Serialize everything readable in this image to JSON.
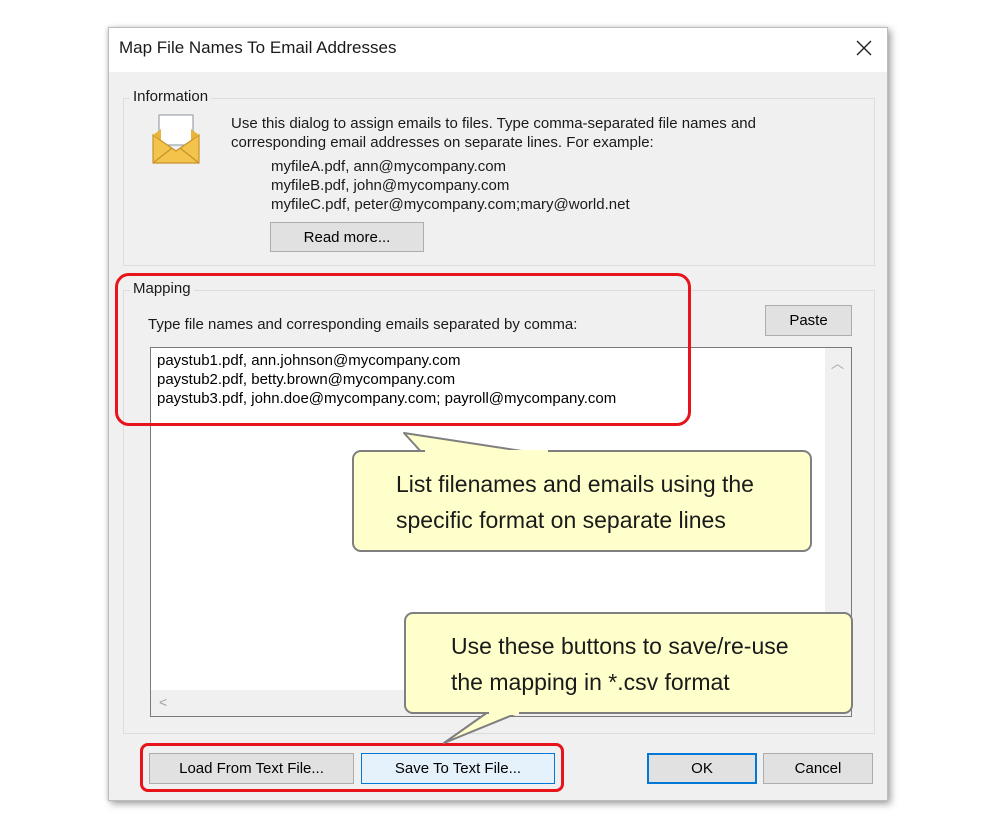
{
  "window": {
    "title": "Map File Names To Email Addresses",
    "close_glyph": "✕"
  },
  "information": {
    "legend": "Information",
    "icon": "envelope-icon",
    "description_line1": "Use this dialog to assign emails to files. Type comma-separated file names and",
    "description_line2": "corresponding email addresses on separate lines. For example:",
    "examples": [
      "myfileA.pdf, ann@mycompany.com",
      "myfileB.pdf, john@mycompany.com",
      "myfileC.pdf, peter@mycompany.com;mary@world.net"
    ],
    "read_more_label": "Read more..."
  },
  "mapping": {
    "legend": "Mapping",
    "instruction": "Type file names and corresponding emails separated by comma:",
    "paste_label": "Paste",
    "lines": [
      "paystub1.pdf, ann.johnson@mycompany.com",
      "paystub2.pdf, betty.brown@mycompany.com",
      "paystub3.pdf, john.doe@mycompany.com; payroll@mycompany.com"
    ],
    "scroll_up_glyph": "︿",
    "scroll_left_glyph": "<"
  },
  "footer": {
    "load_label": "Load From Text File...",
    "save_label": "Save To Text File...",
    "ok_label": "OK",
    "cancel_label": "Cancel"
  },
  "annotations": {
    "callout1_line1": "List filenames and emails using the",
    "callout1_line2": "specific format on separate lines",
    "callout2_line1": "Use these buttons to save/re-use",
    "callout2_line2": "the mapping in *.csv format",
    "highlight_color": "#e8141b",
    "callout_fill": "#ffffcc"
  }
}
